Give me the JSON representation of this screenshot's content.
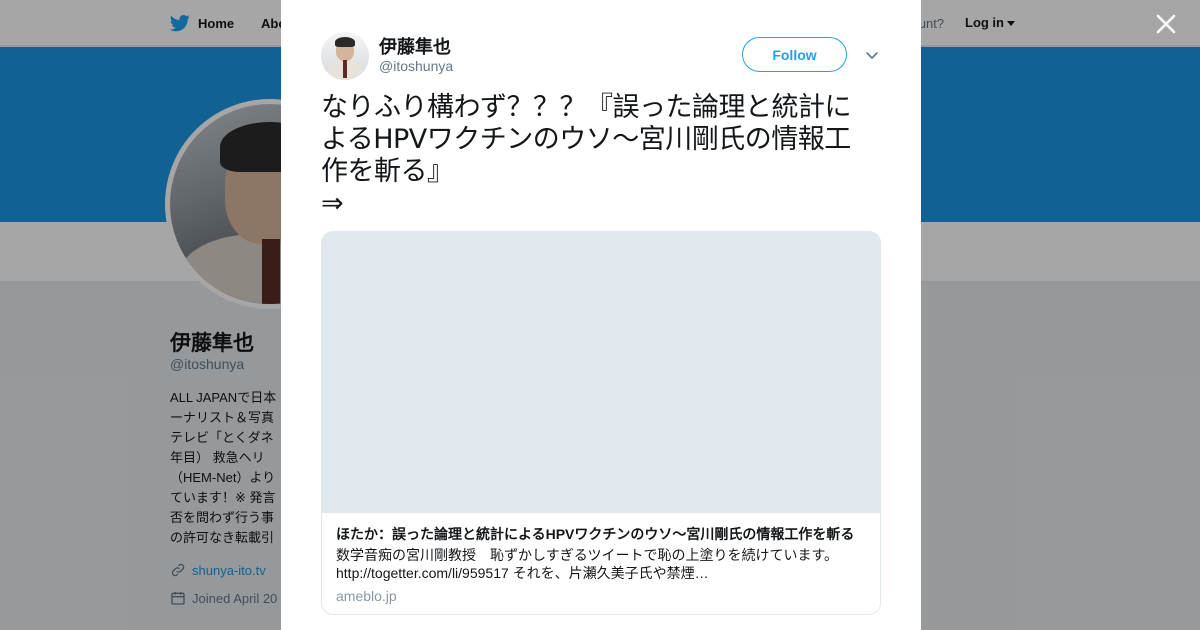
{
  "topbar": {
    "home_label": "Home",
    "about_label": "Abo",
    "account_text": "count?",
    "login_label": "Log in"
  },
  "profile": {
    "name": "伊藤隼也",
    "handle": "@itoshunya",
    "bio_lines": [
      "ALL JAPANで日本",
      "ーナリスト＆写真",
      "テレビ「とくダネ",
      "年目） 救急ヘリ",
      "（HEM-Net）より",
      "ています！※ 発言",
      "否を問わず行う事",
      "の許可なき転載引"
    ],
    "link": "shunya-ito.tv",
    "joined": "Joined April 20"
  },
  "modal": {
    "author_name": "伊藤隼也",
    "author_handle": "@itoshunya",
    "follow_label": "Follow",
    "tweet_lines": [
      "なりふり構わず？？？『誤った論理と統計に",
      "よるHPVワクチンのウソ～宮川剛氏の情報工",
      "作を斬る』",
      "⇒"
    ],
    "card": {
      "title": "ほたか：誤った論理と統計によるHPVワクチンのウソ～宮川剛氏の情報工作を斬る",
      "description_lines": [
        "数学音痴の宮川剛教授　恥ずかしすぎるツイートで恥の上塗りを続けています。",
        "http://togetter.com/li/959517 それを、片瀬久美子氏や禁煙…"
      ],
      "domain": "ameblo.jp"
    }
  },
  "colors": {
    "brand_blue": "#1da1f2",
    "banner_blue": "#1b95e0",
    "overlay": "rgba(0,0,0,0.35)"
  },
  "icons": {
    "home": "twitter-bird-icon",
    "close": "close-icon",
    "menu": "chevron-down-icon",
    "link": "link-icon",
    "calendar": "calendar-icon"
  }
}
